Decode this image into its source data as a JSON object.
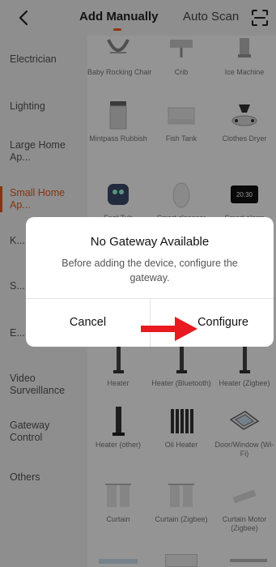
{
  "header": {
    "tab_manual": "Add Manually",
    "tab_auto": "Auto Scan",
    "accent": "#ff5a1f"
  },
  "sidebar": {
    "items": [
      {
        "label": "Electrician"
      },
      {
        "label": "Lighting"
      },
      {
        "label": "Large Home Ap..."
      },
      {
        "label": "Small Home Ap...",
        "active": true
      },
      {
        "label": "K... p..."
      },
      {
        "label": "S... S..."
      },
      {
        "label": "E... Health"
      },
      {
        "label": "Video Surveillance"
      },
      {
        "label": "Gateway Control"
      },
      {
        "label": "Others"
      }
    ],
    "active_color": "#e85a1b"
  },
  "devices": [
    {
      "label": "Baby Rocking Chair"
    },
    {
      "label": "Crib"
    },
    {
      "label": "Ice Machine"
    },
    {
      "label": "Mintpass Rubbish"
    },
    {
      "label": "Fish Tank"
    },
    {
      "label": "Clothes Dryer"
    },
    {
      "label": "Foot Tub"
    },
    {
      "label": "Smart cleanser"
    },
    {
      "label": "Smart alarm"
    },
    {
      "label": "Heater"
    },
    {
      "label": "Heater (Bluetooth)"
    },
    {
      "label": "Heater (Zigbee)"
    },
    {
      "label": "Heater (other)"
    },
    {
      "label": "Oil Heater"
    },
    {
      "label": "Door/Window (Wi-Fi)"
    },
    {
      "label": "Curtain"
    },
    {
      "label": "Curtain (Zigbee)"
    },
    {
      "label": "Curtain Motor (Zigbee)"
    }
  ],
  "alarm_display": "20:30",
  "dialog": {
    "title": "No Gateway Available",
    "message": "Before adding the device, configure the gateway.",
    "cancel": "Cancel",
    "configure": "Configure",
    "arrow_color": "#e8191f"
  }
}
